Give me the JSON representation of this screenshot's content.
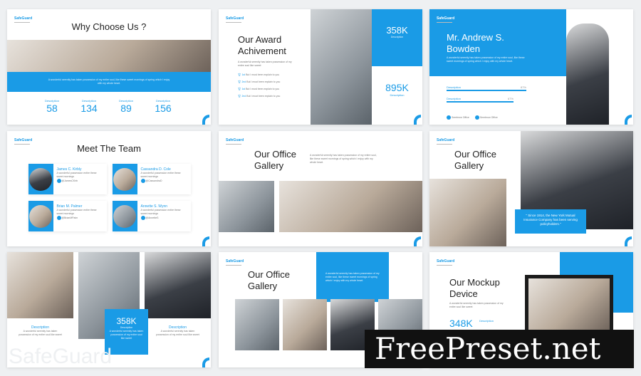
{
  "brand": "SafeGuard",
  "lorem": "A wonderful serenity has taken possession of my entire soul, like these sweet mornings of spring which I enjoy with my whole heart.",
  "lorem_short": "A wonderful serenity has taken possession of my entire soul like sweet",
  "accent_color": "#1a9be6",
  "slide1": {
    "title": "Why Choose Us ?",
    "stats": [
      {
        "label": "Description",
        "value": "58"
      },
      {
        "label": "Description",
        "value": "134"
      },
      {
        "label": "Description",
        "value": "89"
      },
      {
        "label": "Description",
        "value": "156"
      }
    ]
  },
  "slide2": {
    "title_line1": "Our Award",
    "title_line2": "Achivement",
    "awards": [
      {
        "rank": "1st",
        "text": "But I must been explain to you"
      },
      {
        "rank": "2nd",
        "text": "But I must been explain to you"
      },
      {
        "rank": "1st",
        "text": "But I must been explain to you"
      },
      {
        "rank": "2nd",
        "text": "But I must been explain to you"
      }
    ],
    "stat1": {
      "value": "358K",
      "label": "Description"
    },
    "stat2": {
      "value": "895K",
      "label": "Description"
    }
  },
  "slide3": {
    "name_line1": "Mr. Andrew S.",
    "name_line2": "Bowden",
    "bars": [
      {
        "label": "Description",
        "percent": "87%",
        "value": 87
      },
      {
        "label": "Description",
        "percent": "67%",
        "value": 67
      }
    ],
    "socials": [
      "Sembrow Office",
      "Sembrow Office"
    ]
  },
  "slide4": {
    "title": "Meet The Team",
    "members": [
      {
        "name": "James C. Kirbly",
        "desc": "A wonderful possession entire these sweet mornings",
        "handle": "@JamesCKirb"
      },
      {
        "name": "Cassandra D. Cole",
        "desc": "A wonderful possession entire these sweet mornings",
        "handle": "@CassandraD"
      },
      {
        "name": "Brian M. Palmer",
        "desc": "A wonderful possession entire these sweet mornings",
        "handle": "@BrianMPalm"
      },
      {
        "name": "Annette S. Wynn",
        "desc": "A wonderful possession entire these sweet mornings",
        "handle": "@AnnetteS"
      }
    ]
  },
  "slide5": {
    "title_line1": "Our Office",
    "title_line2": "Gallery"
  },
  "slide6": {
    "title_line1": "Our Office",
    "title_line2": "Gallery",
    "quote": "\" Since 1914, the New York Mutual Insurance Company has been serving policyholders.\""
  },
  "slide7": {
    "desc1": "Description",
    "desc2": "Description",
    "stat": {
      "value": "358K",
      "label": "Description"
    },
    "watermark": "SafeGuard"
  },
  "slide8": {
    "title_line1": "Our Office",
    "title_line2": "Gallery"
  },
  "slide9": {
    "title_line1": "Our Mockup",
    "title_line2": "Device",
    "stat": {
      "value": "348K",
      "label": "Description"
    }
  },
  "watermark": "FreePreset.net"
}
